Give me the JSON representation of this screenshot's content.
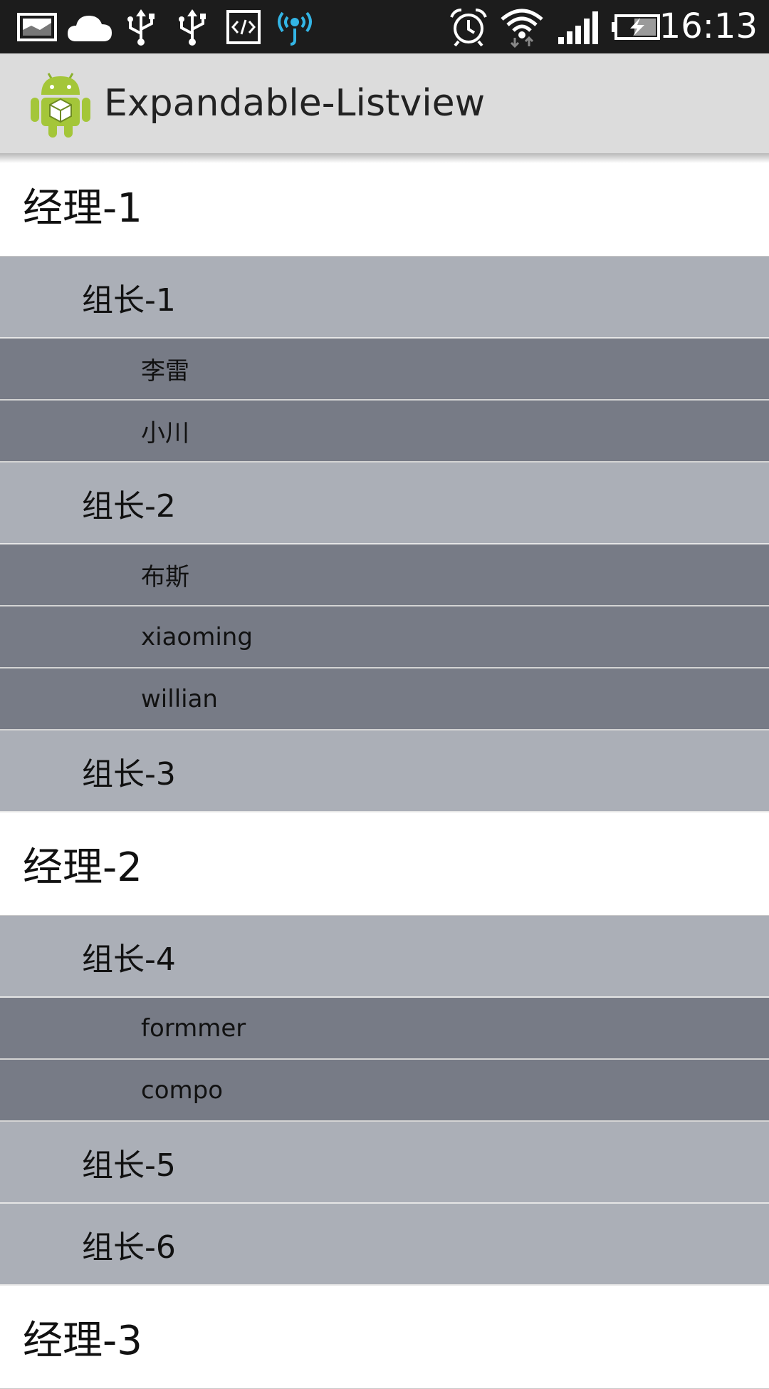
{
  "status_bar": {
    "icons": [
      "gallery-icon",
      "cloud-icon",
      "usb-icon",
      "usb-icon",
      "code-icon",
      "wireless-debug-icon",
      "alarm-icon",
      "wifi-icon",
      "signal-icon",
      "battery-charging-icon"
    ],
    "time": "16:13"
  },
  "action_bar": {
    "app_icon": "android-icon",
    "title": "Expandable-Listview"
  },
  "list": {
    "rows": [
      {
        "level": 1,
        "label": "经理-1"
      },
      {
        "level": 2,
        "label": "组长-1"
      },
      {
        "level": 3,
        "label": "李雷"
      },
      {
        "level": 3,
        "label": "小川"
      },
      {
        "level": 2,
        "label": "组长-2"
      },
      {
        "level": 3,
        "label": "布斯"
      },
      {
        "level": 3,
        "label": "xiaoming"
      },
      {
        "level": 3,
        "label": "willian"
      },
      {
        "level": 2,
        "label": "组长-3"
      },
      {
        "level": 1,
        "label": "经理-2"
      },
      {
        "level": 2,
        "label": "组长-4"
      },
      {
        "level": 3,
        "label": "formmer"
      },
      {
        "level": 3,
        "label": "compo"
      },
      {
        "level": 2,
        "label": "组长-5"
      },
      {
        "level": 2,
        "label": "组长-6"
      },
      {
        "level": 1,
        "label": "经理-3"
      }
    ]
  },
  "colors": {
    "status_bar_bg": "#1c1c1c",
    "action_bar_bg": "#dcdcdc",
    "level1_bg": "#ffffff",
    "level2_bg": "#abafb7",
    "level3_bg": "#777b86",
    "wireless_debug_accent": "#33b5e5",
    "android_green": "#a4c639"
  }
}
